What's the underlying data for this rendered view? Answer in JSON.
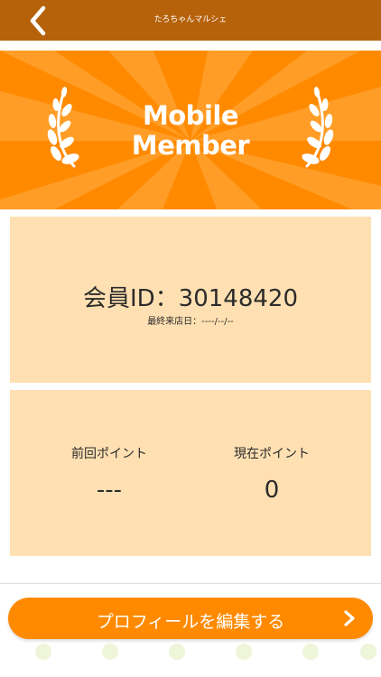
{
  "header": {
    "title": "たろちゃんマルシェ",
    "back_icon": "chevron-left-icon"
  },
  "banner": {
    "title_line1": "Mobile",
    "title_line2": "Member",
    "background": "#ff8a00",
    "laurel_icon": "laurel-icon"
  },
  "member": {
    "id_text": "会員ID：30148420",
    "last_visit": "最終来店日：----/--/--"
  },
  "points": {
    "previous_label": "前回ポイント",
    "previous_value": "---",
    "current_label": "現在ポイント",
    "current_value": "0"
  },
  "actions": {
    "edit_profile_label": "プロフィールを編集する",
    "chevron_icon": "chevron-right-icon"
  },
  "colors": {
    "header": "#b5620b",
    "accent": "#ff8a00",
    "card": "#ffe0b2"
  }
}
